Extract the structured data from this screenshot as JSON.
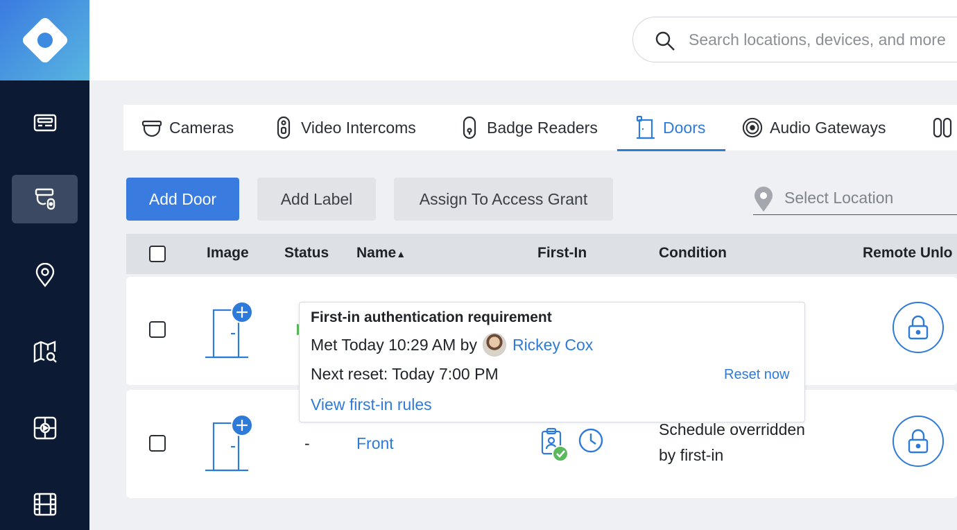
{
  "search": {
    "placeholder": "Search locations, devices, and more"
  },
  "tabs": [
    {
      "label": "Cameras",
      "icon": "camera-icon"
    },
    {
      "label": "Video Intercoms",
      "icon": "intercom-icon"
    },
    {
      "label": "Badge Readers",
      "icon": "badge-reader-icon"
    },
    {
      "label": "Doors",
      "icon": "door-icon",
      "active": true
    },
    {
      "label": "Audio Gateways",
      "icon": "audio-gateway-icon"
    }
  ],
  "actions": {
    "add_door": "Add Door",
    "add_label": "Add Label",
    "assign_grant": "Assign To Access Grant"
  },
  "location": {
    "placeholder": "Select Location"
  },
  "table": {
    "headers": {
      "image": "Image",
      "status": "Status",
      "name": "Name",
      "first_in": "First-In",
      "condition": "Condition",
      "remote_unlock": "Remote Unlo"
    },
    "sort_indicator": "▲",
    "rows": [
      {
        "status": "",
        "name": "",
        "condition": ""
      },
      {
        "status": "-",
        "name": "Front",
        "condition_line1": "Schedule overridden",
        "condition_line2": "by first-in"
      }
    ]
  },
  "popover": {
    "title": "First-in authentication requirement",
    "met_prefix": "Met Today 10:29 AM by",
    "user": "Rickey Cox",
    "next_reset": "Next reset: Today 7:00 PM",
    "reset_now": "Reset now",
    "view_rules": "View first-in rules"
  },
  "colors": {
    "accent": "#2e7ad8",
    "sidebar": "#0c1a33",
    "success": "#5cb85c"
  }
}
